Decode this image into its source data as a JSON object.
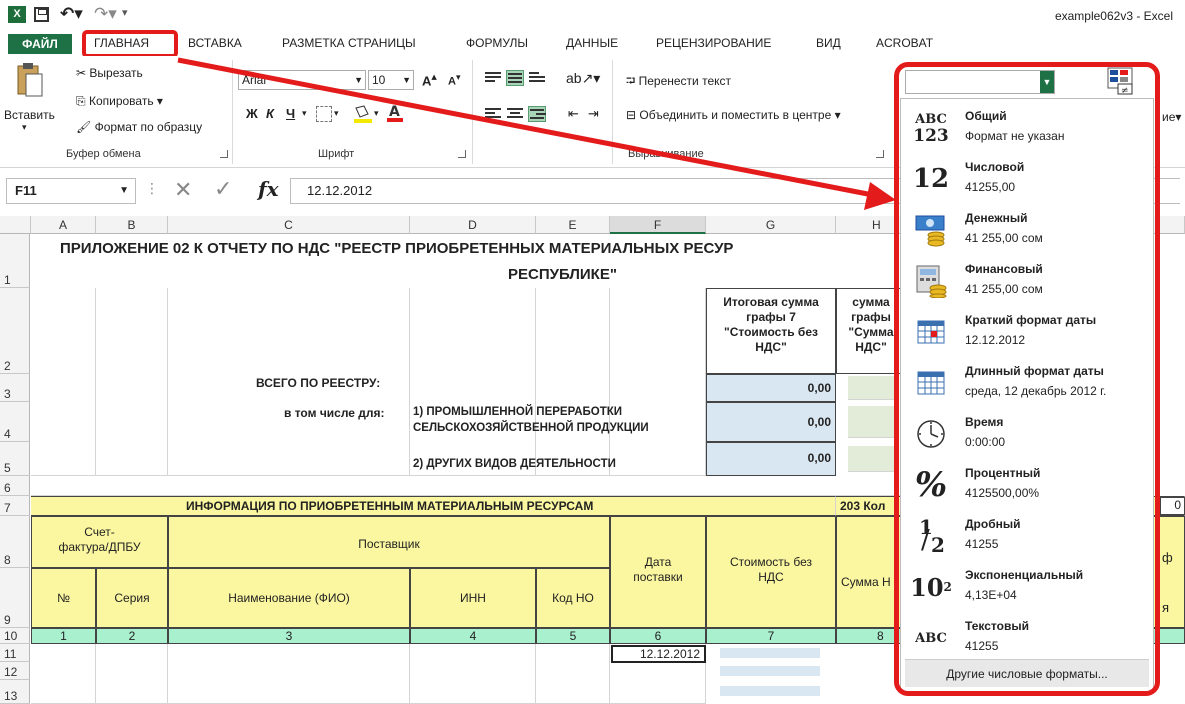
{
  "window": {
    "title": "example062v3 - Excel",
    "qa_more": "▾"
  },
  "tabs": {
    "file": "ФАЙЛ",
    "items": [
      "ГЛАВНАЯ",
      "ВСТАВКА",
      "РАЗМЕТКА СТРАНИЦЫ",
      "ФОРМУЛЫ",
      "ДАННЫЕ",
      "РЕЦЕНЗИРОВАНИЕ",
      "ВИД",
      "ACROBAT"
    ]
  },
  "ribbon": {
    "clipboard": {
      "paste": "Вставить",
      "cut": "Вырезать",
      "copy": "Копировать",
      "copy_dd": "▾",
      "format_painter": "Формат по образцу",
      "label": "Буфер обмена"
    },
    "font": {
      "name": "Arial",
      "size": "10",
      "grow": "A",
      "shrink": "A",
      "bold": "Ж",
      "italic": "К",
      "underline": "Ч",
      "label": "Шрифт"
    },
    "alignment": {
      "wrap": "Перенести текст",
      "merge": "Объединить и поместить в центре",
      "merge_dd": "▾",
      "label": "Выравнивание"
    },
    "number": {
      "combo_value": "",
      "styles_fragment": "ие▾"
    }
  },
  "formula_bar": {
    "name_box": "F11",
    "value": "12.12.2012",
    "fx": "fx"
  },
  "columns": [
    "A",
    "B",
    "C",
    "D",
    "E",
    "F",
    "G",
    "H"
  ],
  "rows": [
    "1",
    "2",
    "3",
    "4",
    "5",
    "6",
    "7",
    "8",
    "9",
    "10",
    "11",
    "12",
    "13"
  ],
  "sheet": {
    "title_line1": "ПРИЛОЖЕНИЕ 02 К ОТЧЕТУ ПО НДС \"РЕЕСТР ПРИОБРЕТЕННЫХ МАТЕРИАЛЬНЫХ РЕСУР",
    "title_line2": "РЕСПУБЛИКЕ\"",
    "g2": [
      "Итоговая сумма",
      "графы 7",
      "\"Стоимость без",
      "НДС\""
    ],
    "h2": [
      "сумма",
      "графы",
      "\"Сумма",
      "НДС\""
    ],
    "total_label": "ВСЕГО ПО РЕЕСТРУ:",
    "incl_label": "в том числе для:",
    "d4": [
      "1) ПРОМЫШЛЕННОЙ ПЕРЕРАБОТКИ",
      "СЕЛЬСКОХОЗЯЙСТВЕННОЙ ПРОДУКЦИИ"
    ],
    "d5": "2) ДРУГИХ ВИДОВ ДЕЯТЕЛЬНОСТИ",
    "zero": "0,00",
    "info_header": "ИНФОРМАЦИЯ ПО ПРИОБРЕТЕННЫМ МАТЕРИАЛЬНЫМ РЕСУРСАМ",
    "h7": "203  Кол",
    "h7_right": "0",
    "invoice": [
      "Счет-",
      "фактура/ДПБУ"
    ],
    "supplier": "Поставщик",
    "delivery": [
      "Дата",
      "поставки"
    ],
    "cost": [
      "Стоимость без",
      "НДС"
    ],
    "vat_sum": "Сумма Н",
    "right_frag1": "ф",
    "right_frag2": "я",
    "sub": {
      "no": "№",
      "series": "Серия",
      "name": "Наименование (ФИО)",
      "inn": "ИНН",
      "code": "Код НО"
    },
    "nums": [
      "1",
      "2",
      "3",
      "4",
      "5",
      "6",
      "7",
      "8"
    ],
    "f11": "12.12.2012"
  },
  "number_formats": [
    {
      "name": "Общий",
      "example": "Формат не указан",
      "icon": "abc123-icon"
    },
    {
      "name": "Числовой",
      "example": "41255,00",
      "icon": "number-12-icon"
    },
    {
      "name": "Денежный",
      "example": "41 255,00 сом",
      "icon": "currency-icon"
    },
    {
      "name": "Финансовый",
      "example": " 41 255,00 сом",
      "icon": "accounting-icon"
    },
    {
      "name": "Краткий формат даты",
      "example": "12.12.2012",
      "icon": "short-date-icon"
    },
    {
      "name": "Длинный формат даты",
      "example": "среда, 12 декабрь 2012 г.",
      "icon": "long-date-icon"
    },
    {
      "name": "Время",
      "example": "0:00:00",
      "icon": "clock-icon"
    },
    {
      "name": "Процентный",
      "example": "4125500,00%",
      "icon": "percent-icon"
    },
    {
      "name": "Дробный",
      "example": "41255",
      "icon": "fraction-icon"
    },
    {
      "name": "Экспоненциальный",
      "example": "4,13E+04",
      "icon": "scientific-icon"
    },
    {
      "name": "Текстовый",
      "example": "41255",
      "icon": "text-abc-icon"
    }
  ],
  "more_formats": "Другие числовые форматы...",
  "icon_glyphs": {
    "abc": "ABC",
    "n123": "123",
    "n12": "12",
    "percent": "%",
    "frac_1": "1",
    "frac_2": "2",
    "pow10": "10",
    "pow2": "2",
    "abc2": "ABC"
  },
  "colors": {
    "accent_red": "#e41b1b",
    "excel_green": "#1e7145",
    "yellow_fill": "#fbf7a0",
    "mint_fill": "#a9f0cf"
  }
}
